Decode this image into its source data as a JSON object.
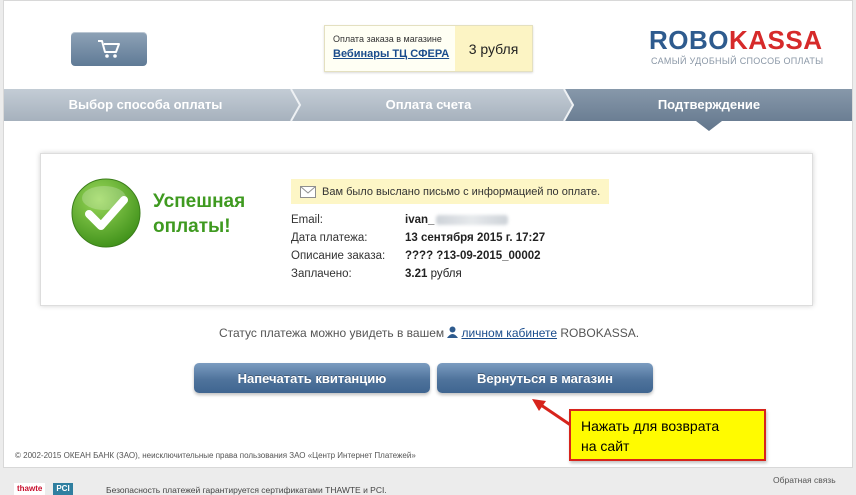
{
  "header": {
    "order": {
      "caption": "Оплата заказа в магазине",
      "shop_link": "Вебинары ТЦ СФЕРА",
      "price": "3 рубля"
    },
    "logo": {
      "part1": "ROBO",
      "part2": "KASSA",
      "tagline": "САМЫЙ УДОБНЫЙ СПОСОБ ОПЛАТЫ"
    }
  },
  "steps": [
    {
      "label": "Выбор способа оплаты"
    },
    {
      "label": "Оплата счета"
    },
    {
      "label": "Подтверждение"
    }
  ],
  "result": {
    "title_line1": "Успешная",
    "title_line2": "оплаты!",
    "notice": "Вам было выслано письмо с информацией по оплате.",
    "fields": [
      {
        "label": "Email:",
        "value": "ivan_"
      },
      {
        "label": "Дата платежа:",
        "value": "13 сентября 2015 г. 17:27"
      },
      {
        "label": "Описание заказа:",
        "value": "???? ?13-09-2015_00002"
      },
      {
        "label": "Заплачено:",
        "value": "3.21",
        "value_rest": " рубля"
      }
    ]
  },
  "status": {
    "before": "Статус платежа можно увидеть в вашем ",
    "link": "личном кабинете",
    "after": " ROBOKASSA."
  },
  "buttons": {
    "print": "Напечатать квитанцию",
    "return": "Вернуться в магазин"
  },
  "annotation": {
    "line1": "Нажать для возврата",
    "line2": "на сайт"
  },
  "footer": {
    "copyright": "© 2002-2015 ОКЕАН БАНК (ЗАО), неисключительные права пользования ЗАО «Центр Интернет Платежей»",
    "feedback": "Обратная связь",
    "badge1": "thawte",
    "badge2": "PCI",
    "security": "Безопасность платежей гарантируется сертификатами THAWTE и PCI."
  },
  "colors": {
    "accent": "#2e5b8e",
    "logo_red": "#d62a2a",
    "success_green": "#3f9a20",
    "button_blue": "#4f739c",
    "step_active": "#6d8196"
  }
}
